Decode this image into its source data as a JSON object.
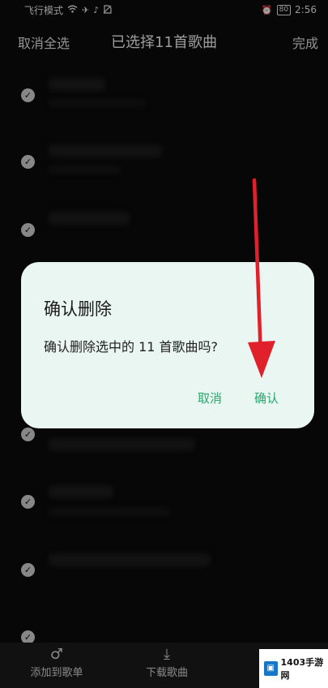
{
  "status_bar": {
    "mode": "飞行模式",
    "icons": [
      "wifi-icon",
      "airplane-icon",
      "vibrate-icon",
      "no-sim-icon"
    ],
    "alarm_icon": "alarm-icon",
    "battery": "80",
    "time": "2:56"
  },
  "title_bar": {
    "cancel_all": "取消全选",
    "title": "已选择11首歌曲",
    "done": "完成"
  },
  "list": {
    "check_glyph": "✓",
    "item_count_visible": 7
  },
  "dialog": {
    "title": "确认删除",
    "message": "确认删除选中的 11 首歌曲吗?",
    "cancel": "取消",
    "confirm": "确认"
  },
  "bottom_bar": {
    "add_to_playlist": "添加到歌单",
    "download": "下载歌曲"
  },
  "watermark": {
    "text": "1403手游网"
  },
  "colors": {
    "dialog_bg": "#e9f6f2",
    "accent_green": "#2aa66f",
    "arrow_red": "#e0202a"
  }
}
